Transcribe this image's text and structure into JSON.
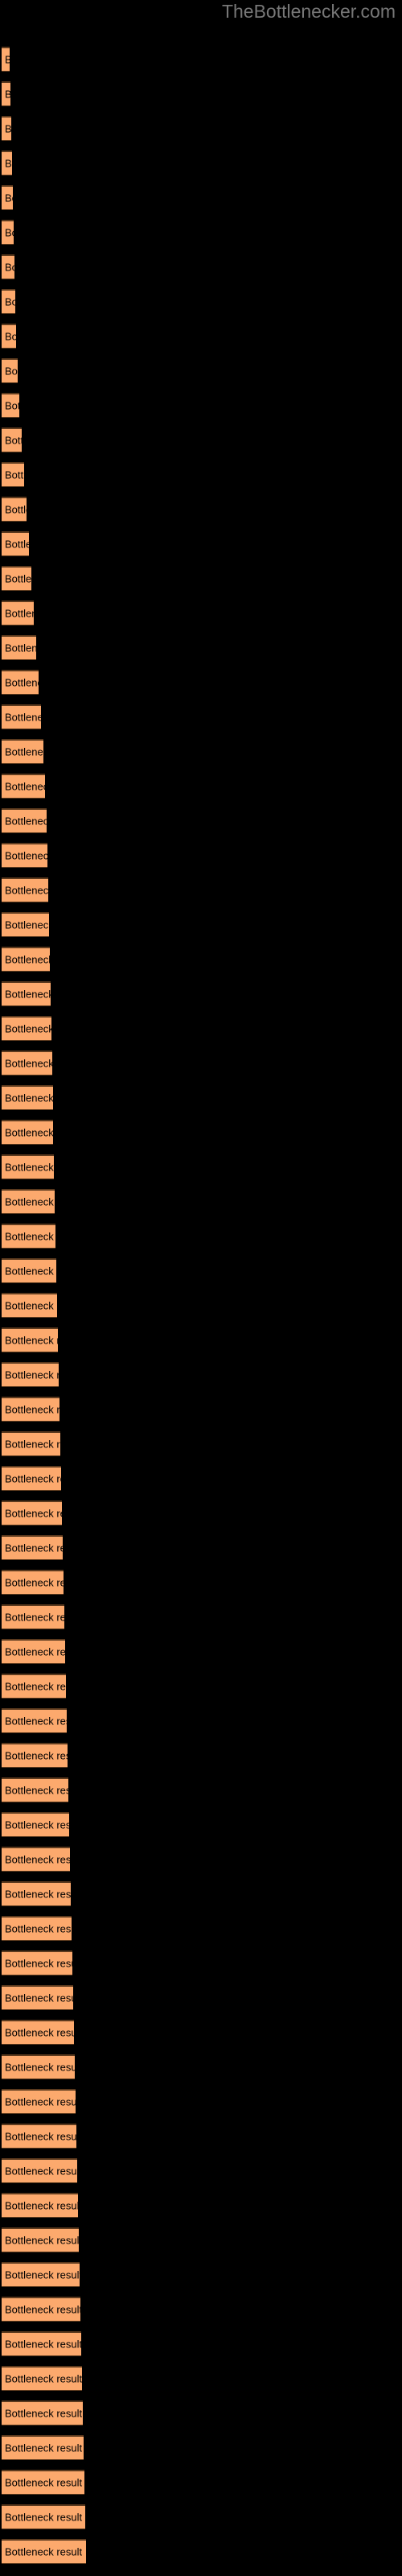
{
  "site": {
    "watermark": "TheBottlenecker.com"
  },
  "chart_data": {
    "type": "bar",
    "orientation": "horizontal",
    "title": "",
    "subtitle": "",
    "xlabel": "",
    "ylabel": "",
    "grid": false,
    "legend": null,
    "legend_position": "none",
    "axis_visible": false,
    "tick_labels_visible": false,
    "bar_color": "#fca96d",
    "bar_edge_color": "#5c3a1e",
    "background_color": "#000000",
    "label_color": "#000000",
    "watermark_color": "#777777",
    "xlim": [
      0,
      500
    ],
    "categories": [
      "Bottleneck result",
      "Bottleneck result",
      "Bottleneck result",
      "Bottleneck result",
      "Bottleneck result",
      "Bottleneck result",
      "Bottleneck result",
      "Bottleneck result",
      "Bottleneck result",
      "Bottleneck result",
      "Bottleneck result",
      "Bottleneck result",
      "Bottleneck result",
      "Bottleneck result",
      "Bottleneck result",
      "Bottleneck result",
      "Bottleneck result",
      "Bottleneck result",
      "Bottleneck result",
      "Bottleneck result",
      "Bottleneck result",
      "Bottleneck result",
      "Bottleneck result",
      "Bottleneck result",
      "Bottleneck result",
      "Bottleneck result",
      "Bottleneck result",
      "Bottleneck result",
      "Bottleneck result",
      "Bottleneck result",
      "Bottleneck result",
      "Bottleneck result",
      "Bottleneck result",
      "Bottleneck result",
      "Bottleneck result",
      "Bottleneck result",
      "Bottleneck result",
      "Bottleneck result",
      "Bottleneck result",
      "Bottleneck result",
      "Bottleneck result",
      "Bottleneck result",
      "Bottleneck result",
      "Bottleneck result",
      "Bottleneck result",
      "Bottleneck result",
      "Bottleneck result",
      "Bottleneck result",
      "Bottleneck result",
      "Bottleneck result",
      "Bottleneck result",
      "Bottleneck result",
      "Bottleneck result",
      "Bottleneck result",
      "Bottleneck result",
      "Bottleneck result",
      "Bottleneck result",
      "Bottleneck result",
      "Bottleneck result",
      "Bottleneck result",
      "Bottleneck result",
      "Bottleneck result",
      "Bottleneck result",
      "Bottleneck result",
      "Bottleneck result",
      "Bottleneck result",
      "Bottleneck result",
      "Bottleneck result",
      "Bottleneck result",
      "Bottleneck result",
      "Bottleneck result",
      "Bottleneck result",
      "Bottleneck result"
    ],
    "values": [
      10,
      11,
      12,
      13,
      14,
      15,
      16,
      17,
      18,
      20,
      22,
      25,
      28,
      31,
      34,
      37,
      40,
      43,
      46,
      49,
      52,
      54,
      56,
      57,
      58,
      59,
      60,
      61,
      62,
      63,
      64,
      64,
      65,
      66,
      67,
      68,
      69,
      70,
      71,
      72,
      73,
      74,
      75,
      76,
      77,
      78,
      79,
      80,
      81,
      82,
      83,
      84,
      85,
      86,
      87,
      88,
      89,
      90,
      91,
      92,
      93,
      94,
      95,
      96,
      97,
      98,
      99,
      100,
      101,
      102,
      103,
      104,
      105
    ],
    "bar_tops": [
      58,
      101,
      144,
      187,
      230,
      273,
      316,
      359,
      402,
      445,
      488,
      531,
      574,
      617,
      660,
      703,
      746,
      789,
      832,
      875,
      918,
      961,
      1004,
      1047,
      1090,
      1133,
      1176,
      1219,
      1262,
      1305,
      1348,
      1391,
      1434,
      1477,
      1520,
      1563,
      1606,
      1649,
      1692,
      1735,
      1778,
      1821,
      1864,
      1907,
      1950,
      1993,
      2036,
      2079,
      2122,
      2165,
      2208,
      2251,
      2294,
      2337,
      2380,
      2423,
      2466,
      2509,
      2552,
      2595,
      2638,
      2681,
      2724,
      2767,
      2810,
      2853,
      2896,
      2939,
      2982,
      3025,
      3068,
      3111,
      3154
    ]
  }
}
